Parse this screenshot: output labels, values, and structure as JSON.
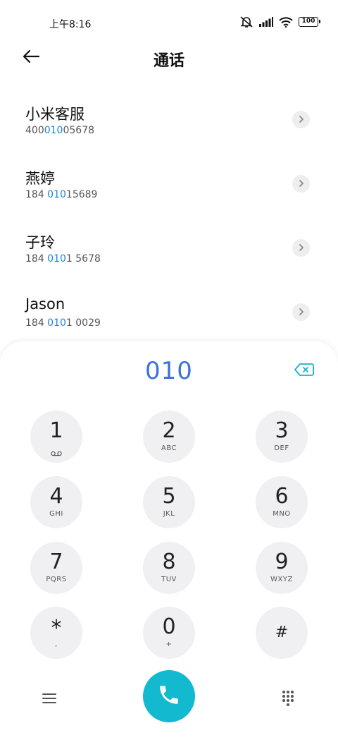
{
  "status_bar": {
    "time": "上午8:16",
    "battery": "100"
  },
  "header": {
    "title": "通话"
  },
  "contacts": [
    {
      "name": "小米客服",
      "number_before": "400",
      "number_match": "010",
      "number_after": "05678"
    },
    {
      "name": "燕婷",
      "number_before": "184 ",
      "number_match": "010",
      "number_after": "15689"
    },
    {
      "name": "子玲",
      "number_before": "184 ",
      "number_match": "010",
      "number_after": "1 5678"
    },
    {
      "name": "Jason",
      "number_before": "184 ",
      "number_match": "010",
      "number_after": "1 0029"
    }
  ],
  "dialpad": {
    "dialed": "010",
    "keys": [
      {
        "digit": "1",
        "letters": ""
      },
      {
        "digit": "2",
        "letters": "ABC"
      },
      {
        "digit": "3",
        "letters": "DEF"
      },
      {
        "digit": "4",
        "letters": "GHI"
      },
      {
        "digit": "5",
        "letters": "JKL"
      },
      {
        "digit": "6",
        "letters": "MNO"
      },
      {
        "digit": "7",
        "letters": "PQRS"
      },
      {
        "digit": "8",
        "letters": "TUV"
      },
      {
        "digit": "9",
        "letters": "WXYZ"
      },
      {
        "digit": "*",
        "letters": ","
      },
      {
        "digit": "0",
        "letters": "+"
      },
      {
        "digit": "#",
        "letters": ""
      }
    ]
  },
  "colors": {
    "accent_blue": "#3d6fe0",
    "match_highlight": "#1a86d8",
    "call_button": "#13b9cf",
    "backspace": "#17b3c8"
  },
  "icons": {
    "back": "arrow-left-icon",
    "detail": "chevron-right-icon",
    "backspace": "backspace-icon",
    "voicemail": "voicemail-icon",
    "menu": "menu-icon",
    "call": "phone-icon",
    "keypad": "dialpad-icon"
  }
}
